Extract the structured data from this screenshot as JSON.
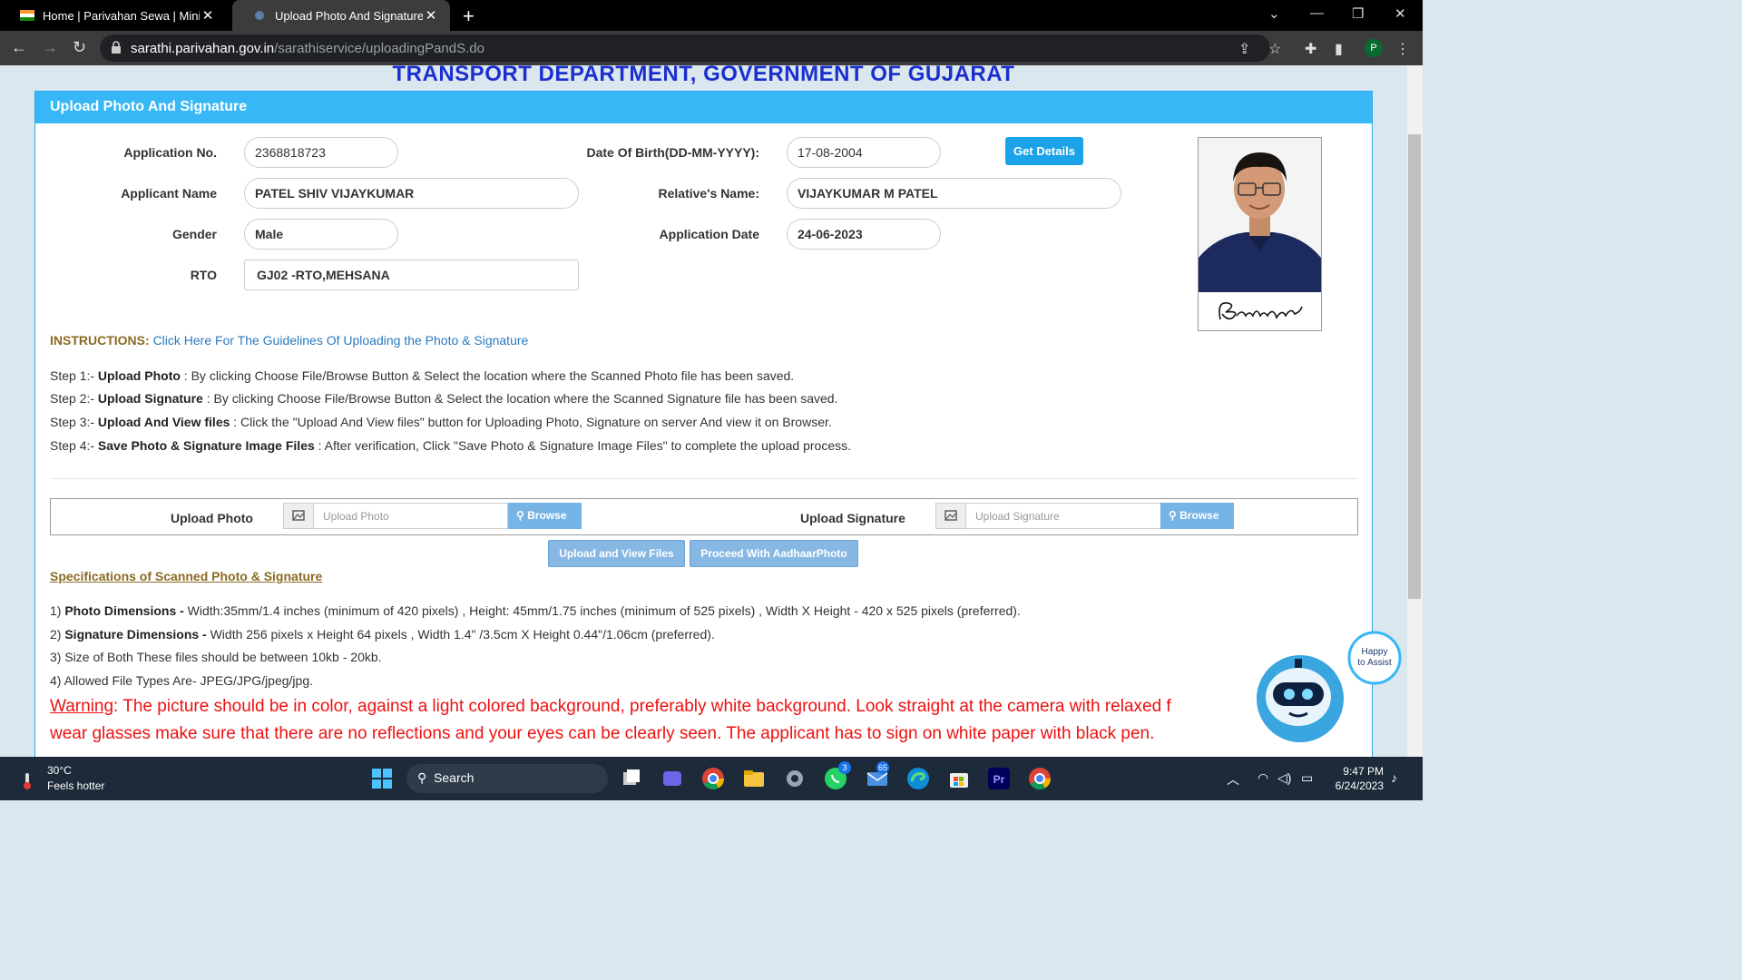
{
  "browser": {
    "tabs": [
      {
        "title": "Home | Parivahan Sewa | Ministry",
        "close": "✕"
      },
      {
        "title": "Upload Photo And Signature",
        "close": "✕"
      }
    ],
    "new_tab": "+",
    "url_domain": "sarathi.parivahan.gov.in",
    "url_path": "/sarathiservice/uploadingPandS.do",
    "profile_initial": "P"
  },
  "page": {
    "department_title": "TRANSPORT DEPARTMENT, GOVERNMENT OF GUJARAT",
    "panel_title": "Upload Photo And Signature",
    "form": {
      "application_no_label": "Application No.",
      "application_no": "2368818723",
      "dob_label": "Date Of Birth(DD-MM-YYYY):",
      "dob": "17-08-2004",
      "get_details": "Get Details",
      "applicant_name_label": "Applicant Name",
      "applicant_name": "PATEL SHIV VIJAYKUMAR",
      "relative_name_label": "Relative's Name:",
      "relative_name": "VIJAYKUMAR M PATEL",
      "gender_label": "Gender",
      "gender": "Male",
      "application_date_label": "Application Date",
      "application_date": "24-06-2023",
      "rto_label": "RTO",
      "rto": "GJ02 -RTO,MEHSANA"
    },
    "instructions_key": "INSTRUCTIONS:",
    "instructions_link": "Click Here For The Guidelines Of Uploading the Photo & Signature",
    "steps": [
      {
        "prefix": "Step 1:-",
        "title": "Upload Photo",
        "text": " : By clicking Choose File/Browse Button & Select the location where the Scanned Photo file has been saved."
      },
      {
        "prefix": "Step 2:-",
        "title": "Upload Signature",
        "text": " : By clicking Choose File/Browse Button & Select the location where the Scanned Signature file has been saved."
      },
      {
        "prefix": "Step 3:-",
        "title": "Upload And View files",
        "text": " : Click the \"Upload And View files\" button for Uploading Photo, Signature on server And view it on Browser."
      },
      {
        "prefix": "Step 4:-",
        "title": "Save Photo & Signature Image Files",
        "text": " : After verification, Click \"Save Photo & Signature Image Files\" to complete the upload process."
      }
    ],
    "upload": {
      "photo_label": "Upload Photo",
      "photo_placeholder": "Upload Photo",
      "signature_label": "Upload Signature",
      "signature_placeholder": "Upload Signature",
      "browse": "Browse"
    },
    "upload_view_button": "Upload and View Files",
    "aadhaar_button": "Proceed With AadhaarPhoto",
    "spec_heading": "Specifications of Scanned Photo & Signature",
    "specs": [
      {
        "num": "1)",
        "title": "Photo Dimensions -",
        "text": " Width:35mm/1.4 inches (minimum of 420 pixels) , Height: 45mm/1.75 inches (minimum of 525 pixels) , Width X Height - 420 x 525 pixels (preferred)."
      },
      {
        "num": "2)",
        "title": "Signature Dimensions -",
        "text": " Width 256 pixels x Height 64 pixels , Width 1.4\" /3.5cm X Height 0.44\"/1.06cm (preferred)."
      },
      {
        "num": "3)",
        "title": "",
        "text": " Size of Both These files should be between 10kb - 20kb."
      },
      {
        "num": "4)",
        "title": "",
        "text": " Allowed File Types Are- JPEG/JPG/jpeg/jpg."
      }
    ],
    "warning_word": "Warning",
    "warning_line1": ": The picture should be in color, against a light colored background, preferably white background. Look straight at the camera with relaxed f",
    "warning_line2": "wear glasses make sure that there are no reflections and your eyes can be clearly seen. The applicant has to sign on white paper with black pen.",
    "assistant_text_1": "Happy",
    "assistant_text_2": "to Assist"
  },
  "taskbar": {
    "temperature": "30°C",
    "weather_text": "Feels hotter",
    "search": "Search",
    "badges": {
      "whatsapp": "3",
      "mail": "65"
    },
    "time": "9:47 PM",
    "date": "6/24/2023"
  },
  "colors": {
    "panel_header": "#37b7f5",
    "dept_title": "#1b2fcf",
    "warning": "#ee1111",
    "link": "#2a7abf"
  }
}
